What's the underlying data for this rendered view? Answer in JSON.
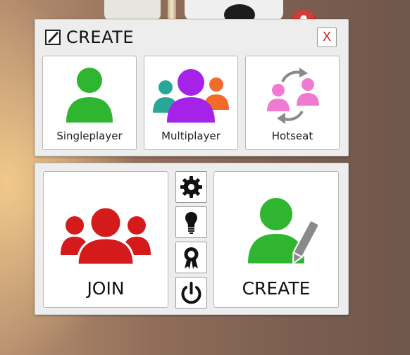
{
  "dialog": {
    "title": "CREATE",
    "close_label": "X"
  },
  "modes": [
    {
      "label": "Singleplayer",
      "icon": "single-user-icon"
    },
    {
      "label": "Multiplayer",
      "icon": "group-users-icon"
    },
    {
      "label": "Hotseat",
      "icon": "swap-users-icon"
    }
  ],
  "actions": {
    "join_label": "JOIN",
    "create_label": "CREATE",
    "tools": [
      "settings-gear-icon",
      "lightbulb-icon",
      "award-ribbon-icon",
      "power-icon"
    ]
  },
  "colors": {
    "green": "#2fb52f",
    "purple": "#a522e8",
    "teal": "#2aa59a",
    "orange": "#f26b2a",
    "pink": "#f07ad2",
    "red": "#d41a1a",
    "gray": "#8a8a8a"
  }
}
